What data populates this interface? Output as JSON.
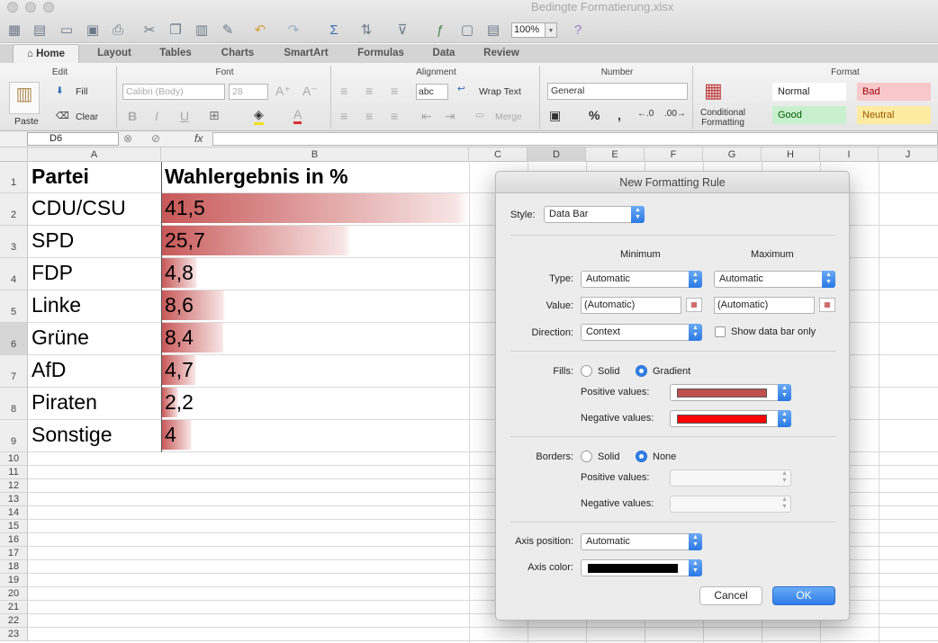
{
  "window": {
    "title": "Bedingte Formatierung.xlsx",
    "zoom": "100%"
  },
  "tabs": [
    "Home",
    "Layout",
    "Tables",
    "Charts",
    "SmartArt",
    "Formulas",
    "Data",
    "Review"
  ],
  "ribbon": {
    "groups": {
      "edit": "Edit",
      "font": "Font",
      "alignment": "Alignment",
      "number": "Number",
      "format": "Format"
    },
    "paste": "Paste",
    "fill": "Fill",
    "clear": "Clear",
    "font_name": "Calibri (Body)",
    "font_size": "28",
    "wrap_text": "Wrap Text",
    "merge": "Merge",
    "abc": "abc",
    "number_format": "General",
    "conditional_formatting": "Conditional Formatting",
    "styles": {
      "normal": "Normal",
      "bad": "Bad",
      "good": "Good",
      "neutral": "Neutral"
    },
    "colors": {
      "bad_bg": "#f8c8cb",
      "bad_fg": "#9c0006",
      "good_bg": "#c8efce",
      "good_fg": "#006100",
      "neutral_bg": "#fdeba0",
      "neutral_fg": "#9c5700"
    }
  },
  "formula_bar": {
    "cell_ref": "D6",
    "fx": "fx"
  },
  "sheet": {
    "columns": [
      "A",
      "B",
      "C",
      "D",
      "E",
      "F",
      "G",
      "H",
      "I",
      "J"
    ],
    "rows": [
      "1",
      "2",
      "3",
      "4",
      "5",
      "6",
      "7",
      "8",
      "9",
      "10",
      "11",
      "12",
      "13",
      "14",
      "15",
      "16",
      "17",
      "18",
      "19",
      "20",
      "21",
      "22",
      "23"
    ],
    "header": {
      "a": "Partei",
      "b": "Wahlergebnis in %"
    },
    "data": [
      {
        "party": "CDU/CSU",
        "value": "41,5",
        "bar_fraction": 1.0
      },
      {
        "party": "SPD",
        "value": "25,7",
        "bar_fraction": 0.619
      },
      {
        "party": "FDP",
        "value": "4,8",
        "bar_fraction": 0.116
      },
      {
        "party": "Linke",
        "value": "8,6",
        "bar_fraction": 0.207
      },
      {
        "party": "Grüne",
        "value": "8,4",
        "bar_fraction": 0.202
      },
      {
        "party": "AfD",
        "value": "4,7",
        "bar_fraction": 0.113
      },
      {
        "party": "Piraten",
        "value": "2,2",
        "bar_fraction": 0.053
      },
      {
        "party": "Sonstige",
        "value": "4",
        "bar_fraction": 0.096
      }
    ],
    "bar_color": "#c85858"
  },
  "dialog": {
    "title": "New Formatting Rule",
    "style_label": "Style:",
    "style_value": "Data Bar",
    "minimum": "Minimum",
    "maximum": "Maximum",
    "type_label": "Type:",
    "type_min": "Automatic",
    "type_max": "Automatic",
    "value_label": "Value:",
    "value_min": "(Automatic)",
    "value_max": "(Automatic)",
    "direction_label": "Direction:",
    "direction_value": "Context",
    "show_bar_only": "Show data bar only",
    "fills_label": "Fills:",
    "solid": "Solid",
    "gradient": "Gradient",
    "positive_values": "Positive values:",
    "negative_values": "Negative values:",
    "positive_fill_color": "#c0504d",
    "negative_fill_color": "#ff0000",
    "borders_label": "Borders:",
    "none": "None",
    "axis_position_label": "Axis position:",
    "axis_position_value": "Automatic",
    "axis_color_label": "Axis color:",
    "axis_color": "#000000",
    "cancel": "Cancel",
    "ok": "OK"
  }
}
